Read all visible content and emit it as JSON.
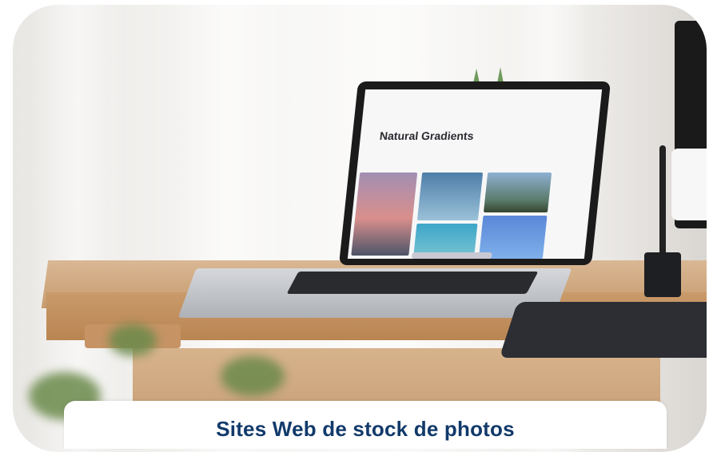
{
  "image": {
    "description_scene": "laptop on wooden desk"
  },
  "laptop_screen": {
    "page_title": "Natural Gradients"
  },
  "caption": {
    "text": "Sites Web de stock de photos"
  },
  "colors": {
    "caption_text": "#123a6b",
    "desk": "#c99a6a",
    "card_background": "#f6f5f3"
  }
}
